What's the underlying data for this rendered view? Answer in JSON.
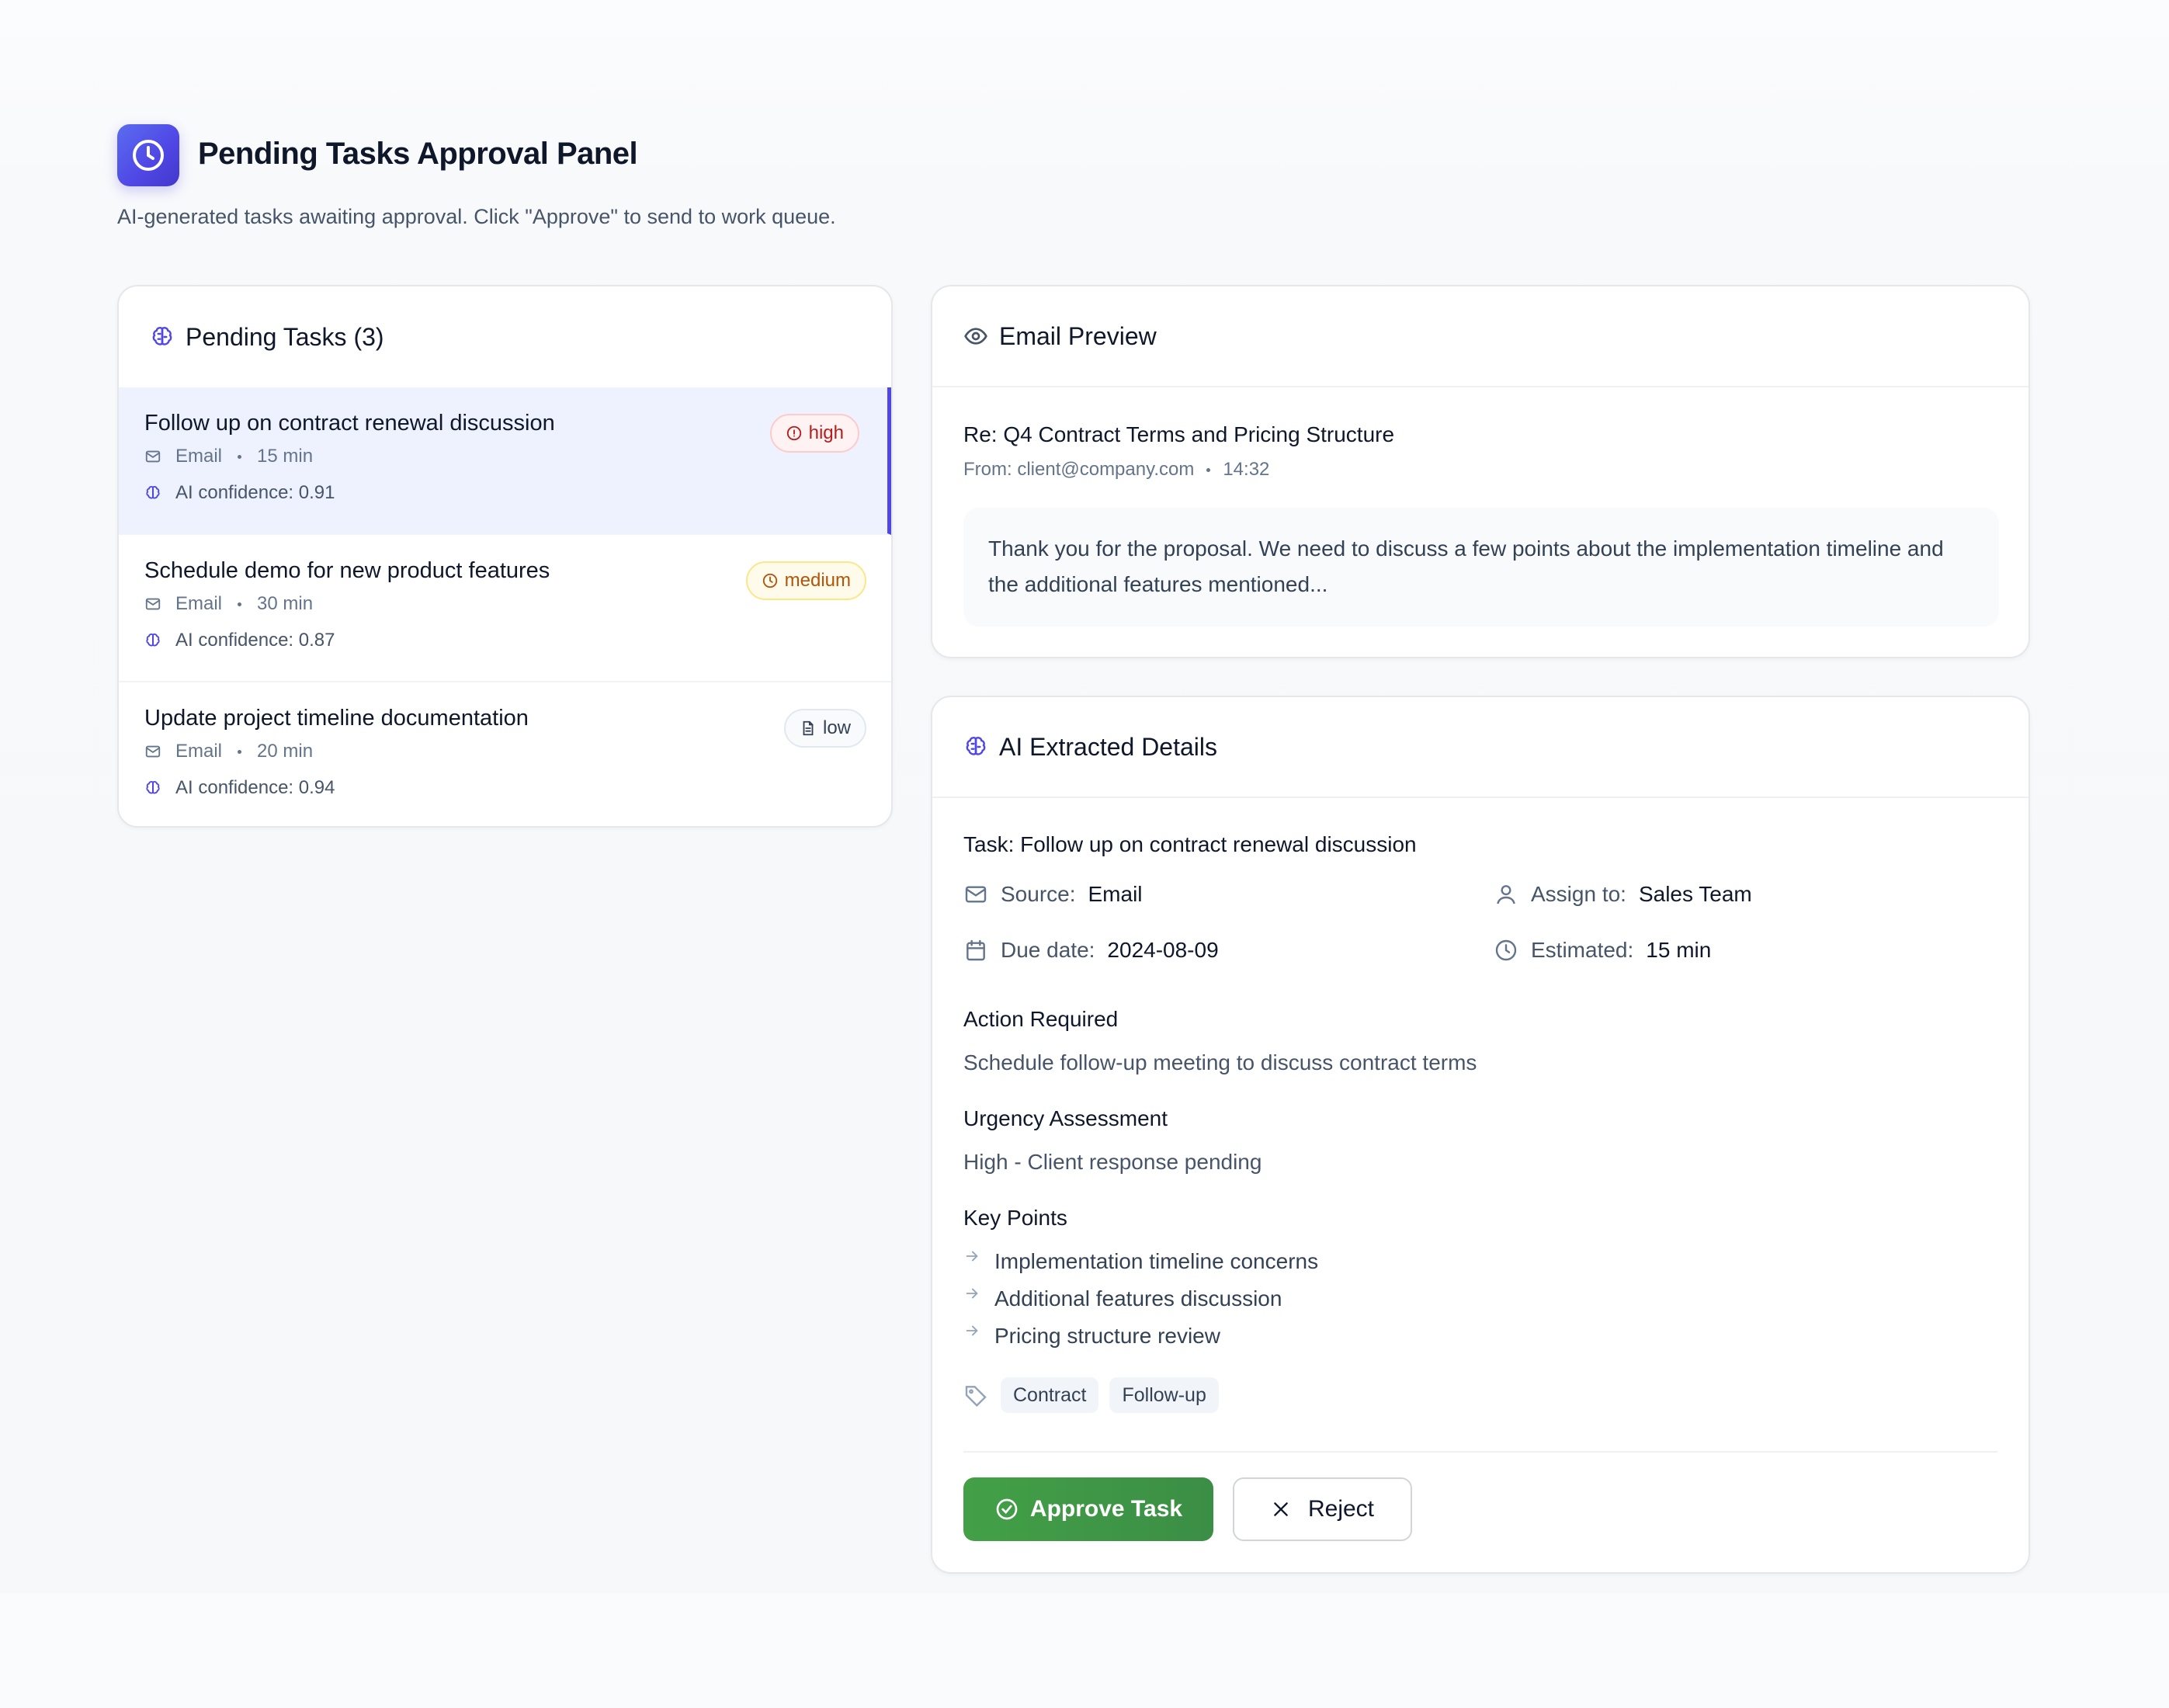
{
  "header": {
    "title": "Pending Tasks Approval Panel",
    "subtitle": "AI-generated tasks awaiting approval. Click \"Approve\" to send to work queue."
  },
  "tasks_panel": {
    "title": "Pending Tasks (3)",
    "items": [
      {
        "title": "Follow up on contract renewal discussion",
        "source": "Email",
        "duration": "15 min",
        "confidence": "AI confidence: 0.91",
        "priority": "high",
        "selected": true
      },
      {
        "title": "Schedule demo for new product features",
        "source": "Email",
        "duration": "30 min",
        "confidence": "AI confidence: 0.87",
        "priority": "medium",
        "selected": false
      },
      {
        "title": "Update project timeline documentation",
        "source": "Email",
        "duration": "20 min",
        "confidence": "AI confidence: 0.94",
        "priority": "low",
        "selected": false
      }
    ]
  },
  "email_preview": {
    "title": "Email Preview",
    "subject": "Re: Q4 Contract Terms and Pricing Structure",
    "from": "From: client@company.com",
    "time": "14:32",
    "body": "Thank you for the proposal. We need to discuss a few points about the implementation timeline and the additional features mentioned..."
  },
  "ai_details": {
    "title": "AI Extracted Details",
    "task": "Task: Follow up on contract renewal discussion",
    "source_label": "Source:",
    "source_value": "Email",
    "assign_label": "Assign to:",
    "assign_value": "Sales Team",
    "due_label": "Due date:",
    "due_value": "2024-08-09",
    "estimated_label": "Estimated:",
    "estimated_value": "15 min",
    "action_heading": "Action Required",
    "action_text": "Schedule follow-up meeting to discuss contract terms",
    "urgency_heading": "Urgency Assessment",
    "urgency_text": "High - Client response pending",
    "keypoints_heading": "Key Points",
    "key_points": [
      "Implementation timeline concerns",
      "Additional features discussion",
      "Pricing structure review"
    ],
    "tags": [
      "Contract",
      "Follow-up"
    ],
    "approve_label": "Approve Task",
    "reject_label": "Reject"
  },
  "colors": {
    "accent": "#4f46e5",
    "approve": "#43a047",
    "high": "#b91c1c",
    "medium": "#b45309"
  }
}
